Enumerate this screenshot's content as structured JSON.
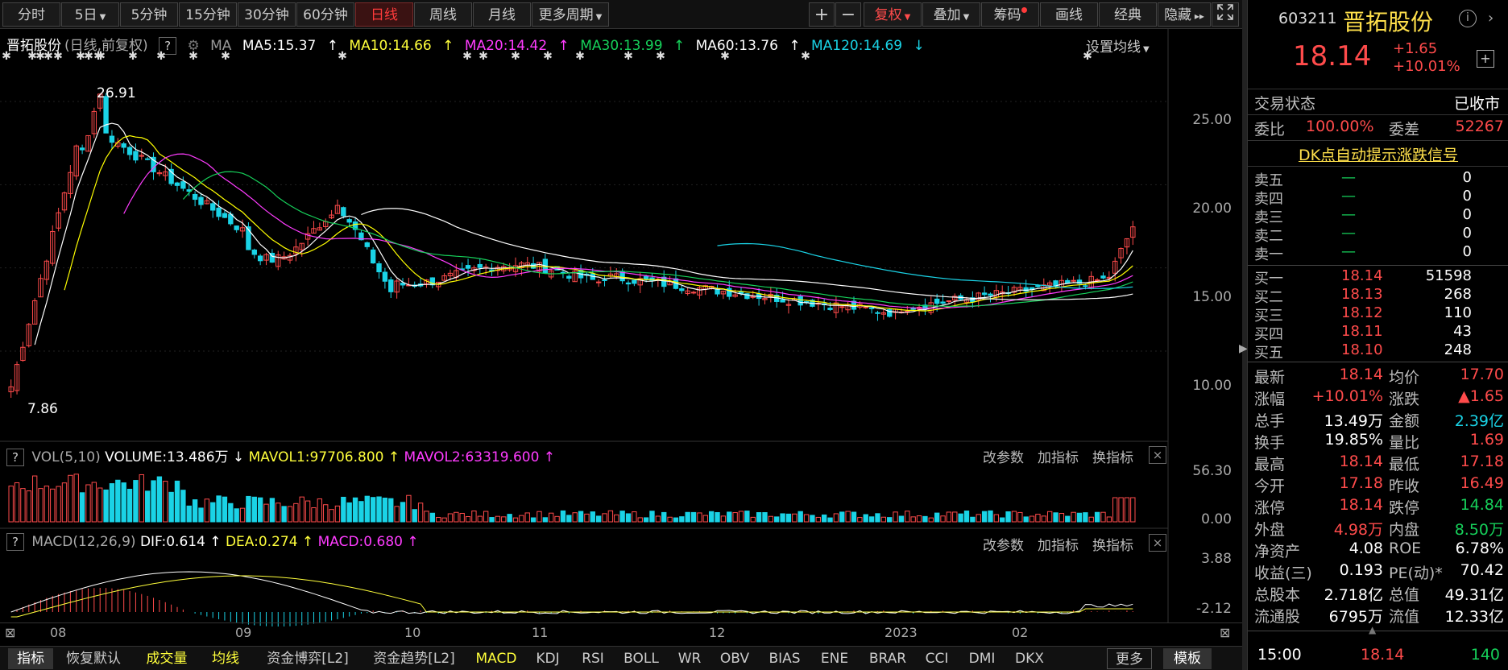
{
  "toolbar": {
    "periods": [
      "分时",
      "5日",
      "5分钟",
      "15分钟",
      "30分钟",
      "60分钟",
      "日线",
      "周线",
      "月线",
      "更多周期"
    ],
    "active": "日线",
    "tools": [
      "复权",
      "叠加",
      "筹码",
      "画线",
      "经典",
      "隐藏"
    ],
    "plus": "+",
    "minus": "−"
  },
  "legend": {
    "name": "晋拓股份",
    "mode": "(日线,前复权)",
    "q": "?",
    "ma": "MA",
    "ma5": "MA5:15.37",
    "ma10": "MA10:14.66",
    "ma20": "MA20:14.42",
    "ma30": "MA30:13.99",
    "ma60": "MA60:13.76",
    "ma120": "MA120:14.69",
    "setting": "设置均线"
  },
  "price_axis": [
    "25.00",
    "20.00",
    "15.00",
    "10.00"
  ],
  "annotations": {
    "high": "26.91",
    "low": "7.86"
  },
  "vol": {
    "q": "?",
    "name": "VOL(5,10)",
    "volume": "VOLUME:13.486万",
    "mavol1": "MAVOL1:97706.800",
    "mavol2": "MAVOL2:63319.600",
    "axis": [
      "56.30",
      "0.00"
    ],
    "btns": [
      "改参数",
      "加指标",
      "换指标"
    ],
    "close": "×"
  },
  "macd": {
    "q": "?",
    "name": "MACD(12,26,9)",
    "dif": "DIF:0.614",
    "dea": "DEA:0.274",
    "macd": "MACD:0.680",
    "axis": [
      "3.88",
      "-2.12"
    ],
    "btns": [
      "改参数",
      "加指标",
      "换指标"
    ],
    "close": "×"
  },
  "date_axis": [
    "08",
    "09",
    "10",
    "11",
    "12",
    "2023",
    "02"
  ],
  "bottom_tabs": [
    "指标",
    "恢复默认",
    "成交量",
    "均线",
    "资金博弈[L2]",
    "资金趋势[L2]",
    "MACD",
    "KDJ",
    "RSI",
    "BOLL",
    "WR",
    "OBV",
    "BIAS",
    "ENE",
    "BRAR",
    "CCI",
    "DMI",
    "DKX",
    "更多",
    "模板"
  ],
  "quote": {
    "code": "603211",
    "name": "晋拓股份",
    "price": "18.14",
    "chg": "+1.65",
    "pct": "+10.01%",
    "status_k": "交易状态",
    "status_v": "已收市",
    "wb_k": "委比",
    "wb_v": "100.00%",
    "wc_k": "委差",
    "wc_v": "52267",
    "signal": "DK点自动提示涨跌信号",
    "asks": [
      {
        "k": "卖五",
        "p": "—",
        "v": "0"
      },
      {
        "k": "卖四",
        "p": "—",
        "v": "0"
      },
      {
        "k": "卖三",
        "p": "—",
        "v": "0"
      },
      {
        "k": "卖二",
        "p": "—",
        "v": "0"
      },
      {
        "k": "卖一",
        "p": "—",
        "v": "0"
      }
    ],
    "bids": [
      {
        "k": "买一",
        "p": "18.14",
        "v": "51598"
      },
      {
        "k": "买二",
        "p": "18.13",
        "v": "268"
      },
      {
        "k": "买三",
        "p": "18.12",
        "v": "110"
      },
      {
        "k": "买四",
        "p": "18.11",
        "v": "43"
      },
      {
        "k": "买五",
        "p": "18.10",
        "v": "248"
      }
    ],
    "stats": [
      [
        "最新",
        "18.14",
        "均价",
        "17.70"
      ],
      [
        "涨幅",
        "+10.01%",
        "涨跌",
        "▲1.65"
      ],
      [
        "总手",
        "13.49万",
        "金额",
        "2.39亿"
      ],
      [
        "换手",
        "19.85%",
        "量比",
        "1.69"
      ],
      [
        "最高",
        "18.14",
        "最低",
        "17.18"
      ],
      [
        "今开",
        "17.18",
        "昨收",
        "16.49"
      ],
      [
        "涨停",
        "18.14",
        "跌停",
        "14.84"
      ],
      [
        "外盘",
        "4.98万",
        "内盘",
        "8.50万"
      ],
      [
        "净资产",
        "4.08",
        "ROE",
        "6.78%"
      ],
      [
        "收益(三)",
        "0.193",
        "PE(动)*",
        "70.42"
      ],
      [
        "总股本",
        "2.718亿",
        "总值",
        "49.31亿"
      ],
      [
        "流通股",
        "6795万",
        "流值",
        "12.33亿"
      ]
    ],
    "tick": {
      "time": "15:00",
      "price": "18.14",
      "vol": "140"
    }
  },
  "colors": {
    "up": "#ff4b4b",
    "down": "#1ad3e6",
    "ma5": "#ffffff",
    "ma10": "#ffff00",
    "ma20": "#ff3cff",
    "ma30": "#16d05a",
    "ma60": "#ffffff",
    "ma120": "#1ad3e6"
  }
}
